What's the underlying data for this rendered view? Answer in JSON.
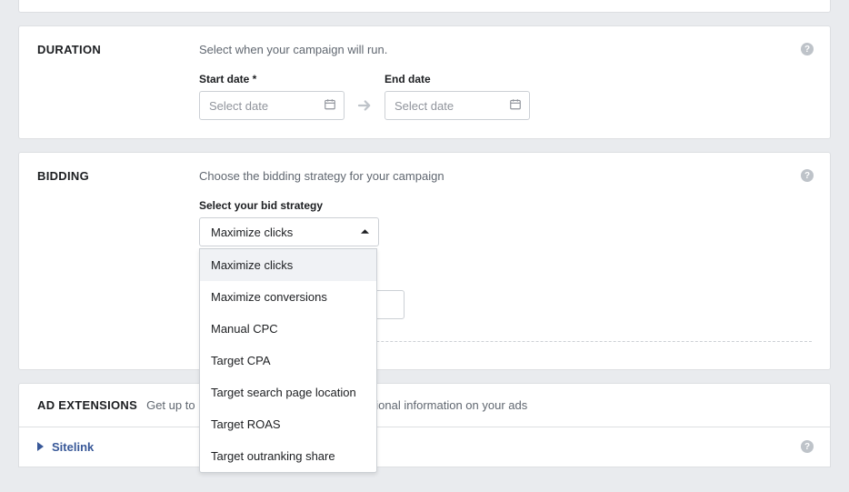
{
  "duration": {
    "title": "DURATION",
    "desc": "Select when your campaign will run.",
    "start_label": "Start date *",
    "end_label": "End date",
    "placeholder": "Select date"
  },
  "bidding": {
    "title": "BIDDING",
    "desc": "Choose the bidding strategy for your campaign",
    "select_label": "Select your bid strategy",
    "selected": "Maximize clicks",
    "options": [
      "Maximize clicks",
      "Maximize conversions",
      "Manual CPC",
      "Target CPA",
      "Target search page location",
      "Target ROAS",
      "Target outranking share"
    ]
  },
  "extensions": {
    "title": "AD EXTENSIONS",
    "sub_left": "Get up to 15",
    "sub_right": "dditional information on your ads",
    "sitelink": "Sitelink"
  }
}
